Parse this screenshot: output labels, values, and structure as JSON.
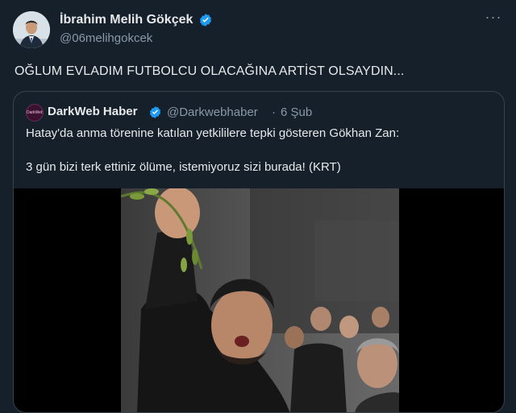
{
  "author": {
    "name": "İbrahim Melih Gökçek",
    "handle": "@06melihgokcek",
    "verified_icon": "verified-badge-icon",
    "accent": "#1d9bf0"
  },
  "tweet": {
    "text": "OĞLUM EVLADIM FUTBOLCU OLACAĞINA ARTİST OLSAYDIN..."
  },
  "quoted": {
    "name": "DarkWeb Haber",
    "avatar_text": "DarkWeb",
    "handle": "@Darkwebhaber",
    "separator": "·",
    "date": "6 Şub",
    "line1": "Hatay'da anma törenine katılan yetkililere tepki gösteren Gökhan Zan:",
    "line2": "3 gün bizi terk ettiniz ölüme, istemiyoruz sizi burada! (KRT)"
  },
  "colors": {
    "background": "#15202b",
    "border": "#38444d",
    "text": "#e7e9ea",
    "muted": "#8b98a5"
  }
}
